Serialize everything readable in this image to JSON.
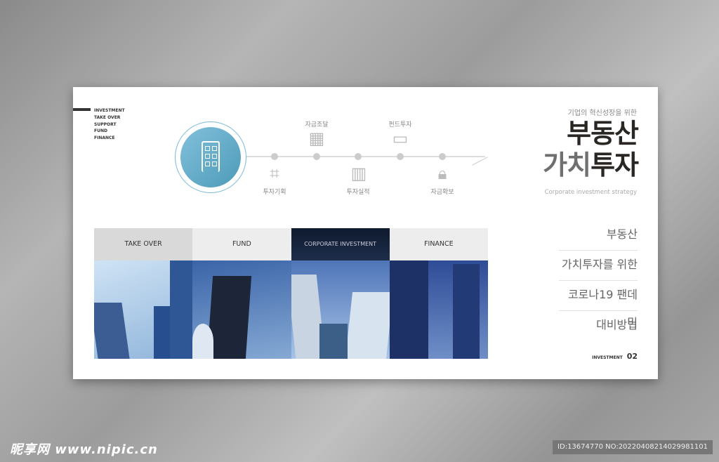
{
  "menu": [
    "INVESTMENT",
    "TAKE OVER",
    "SUPPORT",
    "FUND",
    "FINANCE"
  ],
  "timeline": {
    "top": [
      {
        "label": "자금조달",
        "icon": "gold-bars-icon"
      },
      {
        "label": "펀드투자",
        "icon": "credit-card-icon"
      }
    ],
    "bottom": [
      {
        "label": "투자기획",
        "icon": "presentation-chart-icon"
      },
      {
        "label": "투자실적",
        "icon": "growth-chart-icon"
      },
      {
        "label": "자금확보",
        "icon": "lock-key-icon"
      }
    ],
    "center_icon": "building-icon",
    "accent": "#5fa8c6"
  },
  "header": {
    "subtitle": "기업의 혁신성장을 위한",
    "title1": "부동산",
    "title2a": "가치",
    "title2b": "투자",
    "english": "Corporate investment strategy"
  },
  "list": [
    "부동산",
    "가치투자를 위한",
    "코로나19 팬데믹",
    "대비방법"
  ],
  "footer": {
    "label": "INVESTMENT",
    "page": "02"
  },
  "panels": [
    "TAKE OVER",
    "FUND",
    "CORPORATE INVESTMENT",
    "FINANCE"
  ],
  "watermark": {
    "brand": "昵享网 www.nipic.cn",
    "id": "ID:13674770 NO:20220408214029981101"
  }
}
